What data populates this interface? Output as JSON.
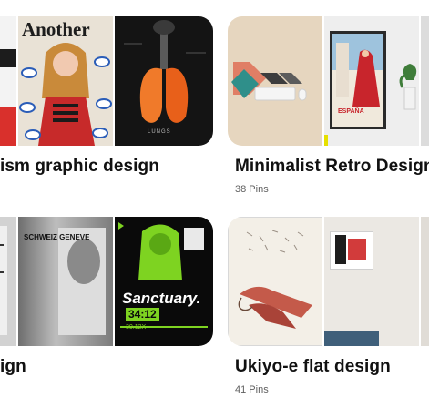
{
  "boards": [
    {
      "title": "ism graphic design",
      "pins": ""
    },
    {
      "title": "Minimalist Retro Design",
      "pins": "38 Pins"
    },
    {
      "title": "ign",
      "pins": ""
    },
    {
      "title": "Ukiyo-e flat design",
      "pins": "41 Pins"
    }
  ],
  "thumb_text": {
    "magazine_title": "Another",
    "lungs_caption": "LUNGS",
    "poster_line": "SCHWEIZ GENEVE",
    "sanctuary": "Sanctuary.",
    "sanctuary_time": "34:12",
    "sanctuary_code": "30.12X",
    "spain_poster": "ESPAÑA"
  },
  "colors": {
    "accent_red": "#d9302c",
    "lime": "#7ed321",
    "salmon": "#e07e65",
    "teal": "#2f8f8a"
  }
}
